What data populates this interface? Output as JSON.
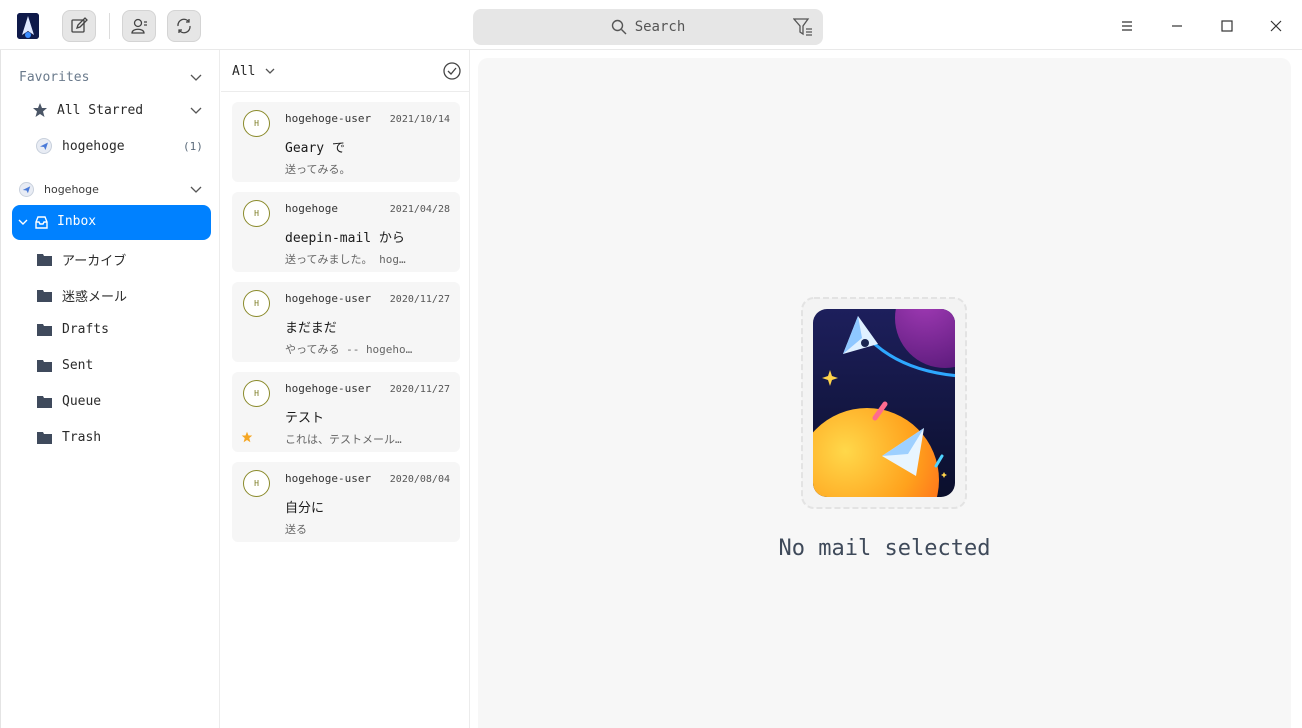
{
  "titlebar": {
    "search_placeholder": "Search"
  },
  "sidebar": {
    "favorites": {
      "title": "Favorites",
      "items": [
        {
          "label": "All Starred",
          "icon": "star-icon"
        },
        {
          "label": "hogehoge",
          "icon": "send-account-icon",
          "count": "(1)"
        }
      ]
    },
    "account": {
      "title": "hogehoge",
      "folders": [
        {
          "label": "Inbox",
          "icon": "inbox-icon",
          "selected": true
        },
        {
          "label": "アーカイブ",
          "icon": "folder-icon"
        },
        {
          "label": "迷惑メール",
          "icon": "folder-icon"
        },
        {
          "label": "Drafts",
          "icon": "folder-icon"
        },
        {
          "label": "Sent",
          "icon": "folder-icon"
        },
        {
          "label": "Queue",
          "icon": "folder-icon"
        },
        {
          "label": "Trash",
          "icon": "folder-icon"
        }
      ]
    }
  },
  "maillist": {
    "filter_label": "All",
    "messages": [
      {
        "avatar": "H",
        "sender": "hogehoge-user",
        "date": "2021/10/14",
        "subject": "Geary で",
        "preview": "送ってみる。",
        "starred": false
      },
      {
        "avatar": "H",
        "sender": "hogehoge",
        "date": "2021/04/28",
        "subject": "deepin-mail から",
        "preview": "送ってみました。 hog…",
        "starred": false
      },
      {
        "avatar": "H",
        "sender": "hogehoge-user",
        "date": "2020/11/27",
        "subject": "まだまだ",
        "preview": "やってみる -- hogeho…",
        "starred": false
      },
      {
        "avatar": "H",
        "sender": "hogehoge-user",
        "date": "2020/11/27",
        "subject": "テスト",
        "preview": "これは、テストメール…",
        "starred": true
      },
      {
        "avatar": "H",
        "sender": "hogehoge-user",
        "date": "2020/08/04",
        "subject": "自分に",
        "preview": "送る",
        "starred": false
      }
    ]
  },
  "reading": {
    "empty_text": "No mail selected"
  },
  "colors": {
    "accent": "#0081ff",
    "star": "#f5a623"
  }
}
